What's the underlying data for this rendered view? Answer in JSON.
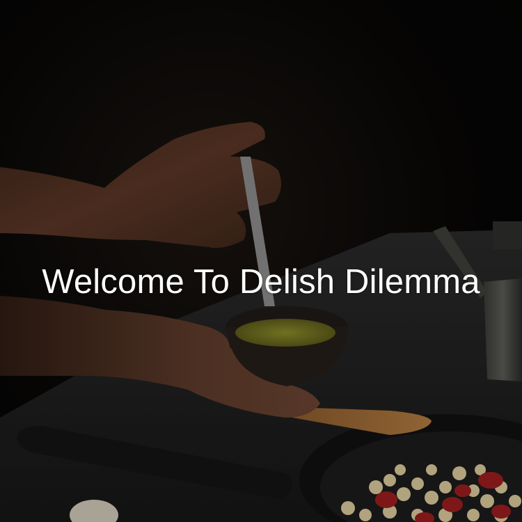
{
  "hero": {
    "title": "Welcome To Delish Dilemma",
    "background_image": "hands-spooning-pesto-over-pasta-pan-photo",
    "overlay_color": "#000000",
    "title_color": "#ffffff"
  }
}
